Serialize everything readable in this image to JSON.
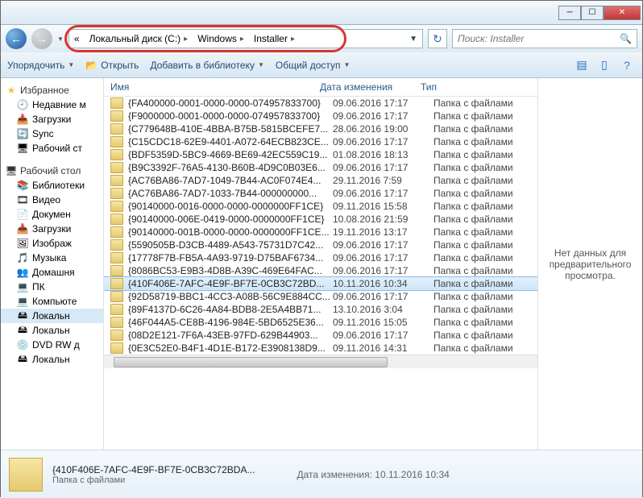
{
  "title": "",
  "breadcrumb": {
    "prefix": "«",
    "parts": [
      "Локальный диск (C:)",
      "Windows",
      "Installer"
    ]
  },
  "search": {
    "placeholder": "Поиск: Installer"
  },
  "toolbar": {
    "organize": "Упорядочить",
    "open": "Открыть",
    "addlib": "Добавить в библиотеку",
    "share": "Общий доступ"
  },
  "sidebar": {
    "fav_header": "Избранное",
    "fav_items": [
      "Недавние м",
      "Загрузки",
      "Sync",
      "Рабочий ст"
    ],
    "desk_header": "Рабочий стол",
    "desk_items": [
      {
        "label": "Библиотеки",
        "icon": "📚"
      },
      {
        "label": "Видео",
        "icon": "🎞"
      },
      {
        "label": "Докумен",
        "icon": "📄"
      },
      {
        "label": "Загрузки",
        "icon": "📥"
      },
      {
        "label": "Изображ",
        "icon": "🖼"
      },
      {
        "label": "Музыка",
        "icon": "🎵"
      },
      {
        "label": "Домашня",
        "icon": "👥"
      },
      {
        "label": "ПК",
        "icon": "💻"
      },
      {
        "label": "Компьюте",
        "icon": "💻"
      },
      {
        "label": "Локальн",
        "icon": "🖴",
        "sel": true
      },
      {
        "label": "Локальн",
        "icon": "🖴"
      },
      {
        "label": "DVD RW д",
        "icon": "💿"
      },
      {
        "label": "Локальн",
        "icon": "🖴"
      }
    ]
  },
  "columns": {
    "name": "Имя",
    "date": "Дата изменения",
    "type": "Тип"
  },
  "files": [
    {
      "name": "{FA400000-0001-0000-0000-074957833700}",
      "date": "09.06.2016 17:17",
      "type": "Папка с файлами"
    },
    {
      "name": "{F9000000-0001-0000-0000-074957833700}",
      "date": "09.06.2016 17:17",
      "type": "Папка с файлами"
    },
    {
      "name": "{C779648B-410E-4BBA-B75B-5815BCEFE7...",
      "date": "28.06.2016 19:00",
      "type": "Папка с файлами"
    },
    {
      "name": "{C15CDC18-62E9-4401-A072-64ECB823CE...",
      "date": "09.06.2016 17:17",
      "type": "Папка с файлами"
    },
    {
      "name": "{BDF5359D-5BC9-4669-BE69-42EC559C19...",
      "date": "01.08.2016 18:13",
      "type": "Папка с файлами"
    },
    {
      "name": "{B9C3392F-76A5-4130-B60B-4D9C0B03E6...",
      "date": "09.06.2016 17:17",
      "type": "Папка с файлами"
    },
    {
      "name": "{AC76BA86-7AD7-1049-7B44-AC0F074E4...",
      "date": "29.11.2016 7:59",
      "type": "Папка с файлами"
    },
    {
      "name": "{AC76BA86-7AD7-1033-7B44-000000000...",
      "date": "09.06.2016 17:17",
      "type": "Папка с файлами"
    },
    {
      "name": "{90140000-0016-0000-0000-0000000FF1CE}",
      "date": "09.11.2016 15:58",
      "type": "Папка с файлами"
    },
    {
      "name": "{90140000-006E-0419-0000-0000000FF1CE}",
      "date": "10.08.2016 21:59",
      "type": "Папка с файлами"
    },
    {
      "name": "{90140000-001B-0000-0000-0000000FF1CE...",
      "date": "19.11.2016 13:17",
      "type": "Папка с файлами"
    },
    {
      "name": "{5590505B-D3CB-4489-A543-75731D7C42...",
      "date": "09.06.2016 17:17",
      "type": "Папка с файлами"
    },
    {
      "name": "{17778F7B-FB5A-4A93-9719-D75BAF6734...",
      "date": "09.06.2016 17:17",
      "type": "Папка с файлами"
    },
    {
      "name": "{8086BC53-E9B3-4D8B-A39C-469E64FAC...",
      "date": "09.06.2016 17:17",
      "type": "Папка с файлами"
    },
    {
      "name": "{410F406E-7AFC-4E9F-BF7E-0CB3C72BD...",
      "date": "10.11.2016 10:34",
      "type": "Папка с файлами",
      "sel": true
    },
    {
      "name": "{92D58719-BBC1-4CC3-A08B-56C9E884CC...",
      "date": "09.06.2016 17:17",
      "type": "Папка с файлами"
    },
    {
      "name": "{89F4137D-6C26-4A84-BDB8-2E5A4BB71...",
      "date": "13.10.2016 3:04",
      "type": "Папка с файлами"
    },
    {
      "name": "{46F044A5-CE8B-4196-984E-5BD6525E36...",
      "date": "09.11.2016 15:05",
      "type": "Папка с файлами"
    },
    {
      "name": "{08D2E121-7F6A-43EB-97FD-629B44903...",
      "date": "09.06.2016 17:17",
      "type": "Папка с файлами"
    },
    {
      "name": "{0E3C52E0-B4F1-4D1E-B172-E3908138D9...",
      "date": "09.11.2016 14:31",
      "type": "Папка с файлами"
    }
  ],
  "preview": {
    "text": "Нет данных для предварительного просмотра."
  },
  "details": {
    "name": "{410F406E-7AFC-4E9F-BF7E-0CB3C72BDA...",
    "type": "Папка с файлами",
    "mod_label": "Дата изменения:",
    "mod_value": "10.11.2016 10:34"
  }
}
